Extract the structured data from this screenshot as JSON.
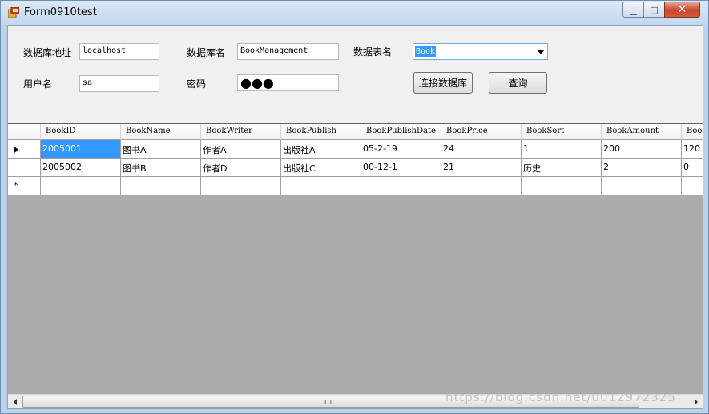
{
  "window": {
    "title": "Form0910test"
  },
  "form": {
    "db_address_label": "数据库地址",
    "db_address_value": "localhost",
    "db_name_label": "数据库名",
    "db_name_value": "BookManagement",
    "table_name_label": "数据表名",
    "table_name_value": "Book",
    "username_label": "用户名",
    "username_value": "sa",
    "password_label": "密码",
    "password_mask": "●●●",
    "connect_button": "连接数据库",
    "query_button": "查询"
  },
  "grid": {
    "columns": [
      "BookID",
      "BookName",
      "BookWriter",
      "BookPublish",
      "BookPublishDate",
      "BookPrice",
      "BookSort",
      "BookAmount",
      "BookF"
    ],
    "rows": [
      [
        "2005001",
        "图书A",
        "作者A",
        "出版社A",
        "05-2-19",
        "24",
        "1",
        "200",
        "120"
      ],
      [
        "2005002",
        "图书B",
        "作者D",
        "出版社C",
        "00-12-1",
        "21",
        "历史",
        "2",
        "0"
      ]
    ],
    "new_row_marker": "*",
    "scroll_grip": "III"
  },
  "watermark": "https://blog.csdn.net/u012972325",
  "colors": {
    "selection": "#3399ff",
    "grid_background": "#ababab"
  }
}
